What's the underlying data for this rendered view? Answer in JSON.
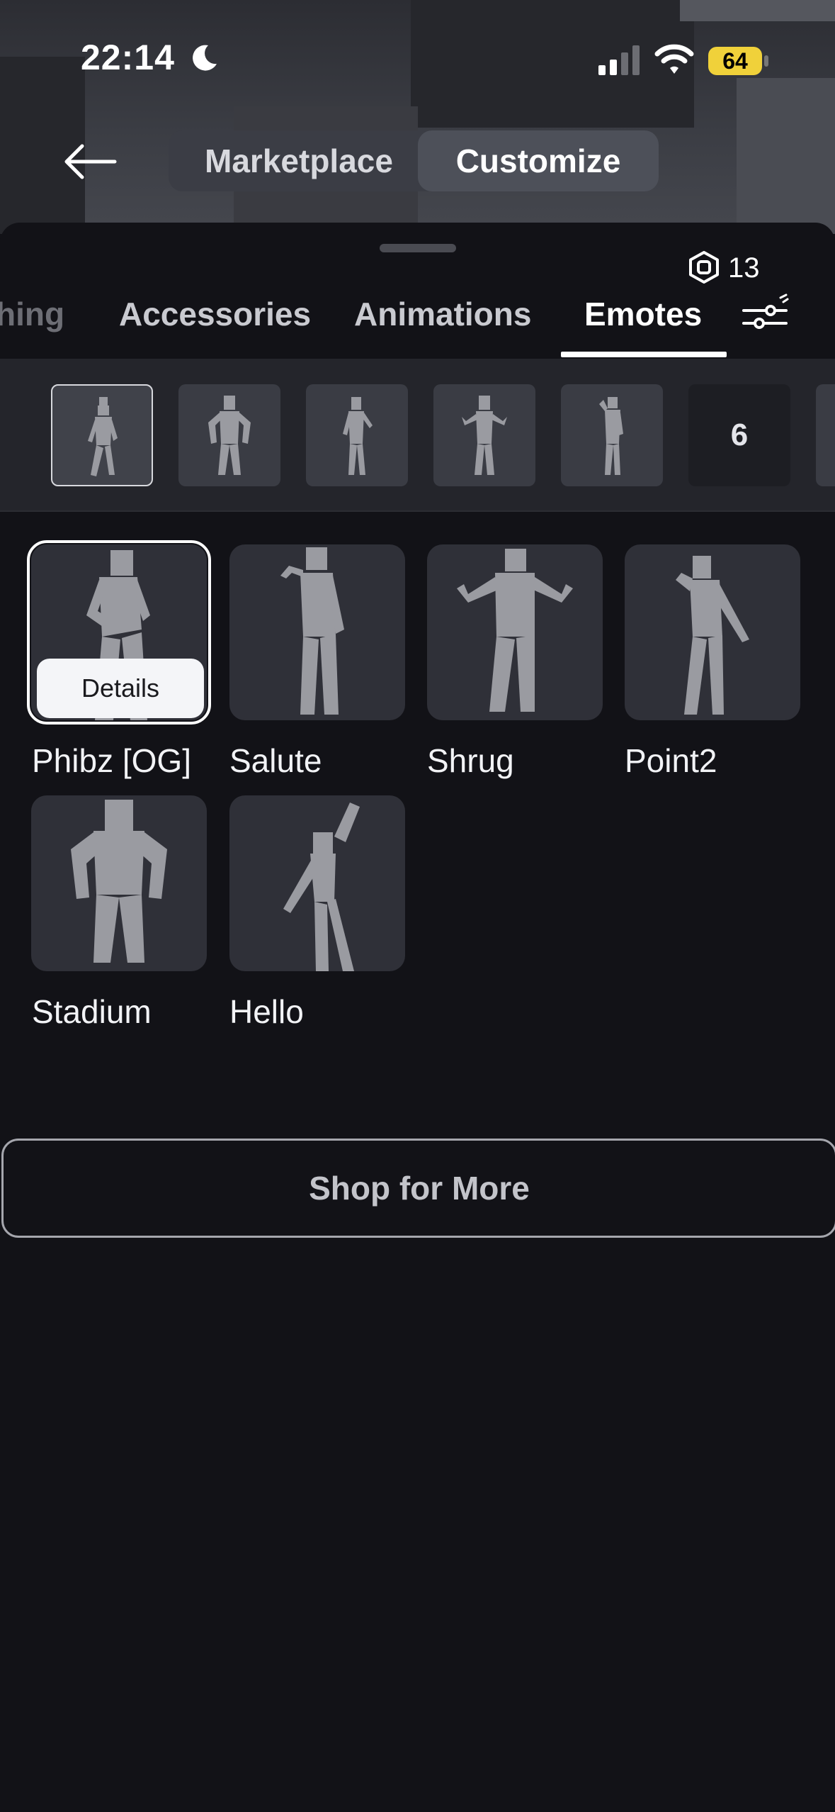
{
  "status_bar": {
    "time": "22:14",
    "battery": "64"
  },
  "header": {
    "tabs": [
      "Marketplace",
      "Customize"
    ],
    "active_tab": "Customize"
  },
  "robux": {
    "count": "13"
  },
  "categories": {
    "partial": "hing",
    "items": [
      "Accessories",
      "Animations",
      "Emotes"
    ],
    "active": "Emotes"
  },
  "slots": {
    "extra_label": "6"
  },
  "emotes": [
    {
      "name": "Phibz [OG]"
    },
    {
      "name": "Salute"
    },
    {
      "name": "Shrug"
    },
    {
      "name": "Point2"
    },
    {
      "name": "Stadium"
    },
    {
      "name": "Hello"
    }
  ],
  "details_label": "Details",
  "shop_button": "Shop for More",
  "colors": {
    "background": "#121217",
    "card": "#2f3038",
    "battery": "#f0d13a",
    "accent": "#ffffff"
  }
}
